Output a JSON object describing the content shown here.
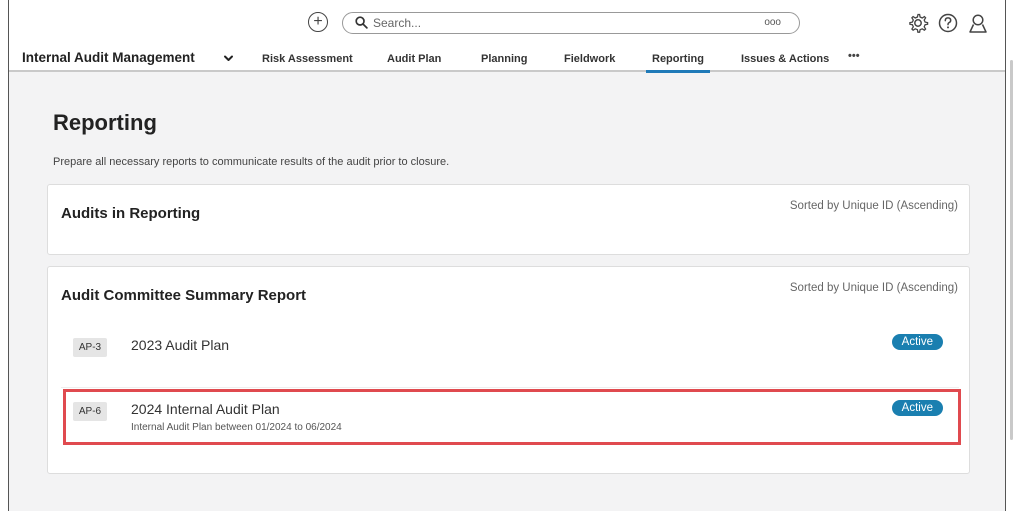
{
  "topbar": {
    "search": {
      "placeholder": "Search...",
      "value": ""
    },
    "add_icon": "plus-circle-icon",
    "search_icon": "magnifier-icon",
    "options_icon": "ooo-icon",
    "options_label": "ooo",
    "settings_icon": "gear-icon",
    "help_icon": "question-circle-icon",
    "user_icon": "user-icon"
  },
  "nav": {
    "app_name": "Internal Audit Management",
    "tabs": [
      {
        "label": "Risk Assessment"
      },
      {
        "label": "Audit Plan"
      },
      {
        "label": "Planning"
      },
      {
        "label": "Fieldwork"
      },
      {
        "label": "Reporting",
        "active": true
      },
      {
        "label": "Issues & Actions"
      }
    ],
    "more_label": "•••"
  },
  "page": {
    "title": "Reporting",
    "description": "Prepare all necessary reports to communicate results of the audit prior to closure."
  },
  "cards": [
    {
      "title": "Audits in Reporting",
      "sort_label": "Sorted by Unique ID (Ascending)",
      "rows": []
    },
    {
      "title": "Audit Committee Summary Report",
      "sort_label": "Sorted by Unique ID (Ascending)",
      "rows": [
        {
          "id": "AP-3",
          "name": "2023 Audit Plan",
          "subtitle": "",
          "status": "Active"
        },
        {
          "id": "AP-6",
          "name": "2024 Internal Audit Plan",
          "subtitle": "Internal Audit Plan between 01/2024 to 06/2024",
          "status": "Active"
        }
      ]
    }
  ],
  "colors": {
    "accent": "#1f7ab8",
    "badge": "#1a7fb0",
    "highlight": "#e04a4f",
    "background": "#f3f3f4"
  }
}
